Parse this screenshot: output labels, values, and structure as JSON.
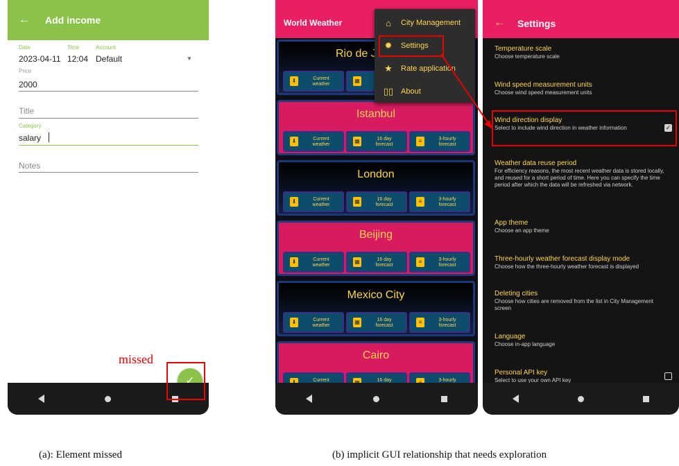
{
  "phone_a": {
    "header": {
      "back_icon": "arrow-left-icon",
      "title": "Add income"
    },
    "fields": {
      "date_label": "Date",
      "date_value": "2023-04-11",
      "time_label": "Time",
      "time_value": "12:04",
      "account_label": "Account",
      "account_value": "Default",
      "price_label": "Price",
      "price_value": "2000",
      "title_placeholder": "Title",
      "category_label": "Category",
      "category_value": "salary",
      "notes_placeholder": "Notes"
    },
    "fab_icon": "✓",
    "annotation": "missed"
  },
  "phone_b": {
    "header_title": "World Weather",
    "menu": [
      {
        "icon": "home-icon",
        "glyph": "⌂",
        "label": "City Management"
      },
      {
        "icon": "gear-icon",
        "glyph": "✹",
        "label": "Settings"
      },
      {
        "icon": "star-icon",
        "glyph": "★",
        "label": "Rate application"
      },
      {
        "icon": "book-icon",
        "glyph": "▯▯",
        "label": "About"
      }
    ],
    "cities": [
      {
        "name": "Rio de J"
      },
      {
        "name": "Istanbul"
      },
      {
        "name": "London"
      },
      {
        "name": "Beijing"
      },
      {
        "name": "Mexico City"
      },
      {
        "name": "Cairo"
      }
    ],
    "buttons": [
      {
        "label1": "Current",
        "label2": "weather"
      },
      {
        "label1": "16 day",
        "label2": "forecast"
      },
      {
        "label1": "3-hourly",
        "label2": "forecast"
      }
    ],
    "first_card_partial": [
      {
        "label1": "Current",
        "label2": "weather"
      },
      {
        "label1": "16",
        "label2": "fo"
      }
    ]
  },
  "phone_c": {
    "header": {
      "title": "Settings"
    },
    "settings": [
      {
        "title": "Temperature scale",
        "summary": "Choose temperature scale"
      },
      {
        "title": "Wind speed measurement units",
        "summary": "Choose wind speed measurement units"
      },
      {
        "title": "Wind direction display",
        "summary": "Select to include wind direction in weather information"
      },
      {
        "title": "Weather data reuse period",
        "summary": "For efficiency reasons, the most recent weather data is stored locally, and reused for a short period of time. Here you can specify the time period after which the data will be refreshed via network."
      },
      {
        "title": "App theme",
        "summary": "Choose an app theme"
      },
      {
        "title": "Three-hourly weather forecast display mode",
        "summary": "Choose how the three-hourly weather forecast is displayed"
      },
      {
        "title": "Deleting cities",
        "summary": "Choose how cities are removed from the list in City Management screen"
      },
      {
        "title": "Language",
        "summary": "Choose in-app language"
      },
      {
        "title": "Personal API key",
        "summary": "Select to use your own API key"
      }
    ]
  },
  "captions": {
    "a": "(a): Element missed",
    "b": "(b) implicit GUI relationship that needs exploration"
  },
  "colors": {
    "green": "#8bc34a",
    "pink": "#e91e63",
    "yellow": "#ffd54f",
    "annotation_red": "#e60000"
  }
}
